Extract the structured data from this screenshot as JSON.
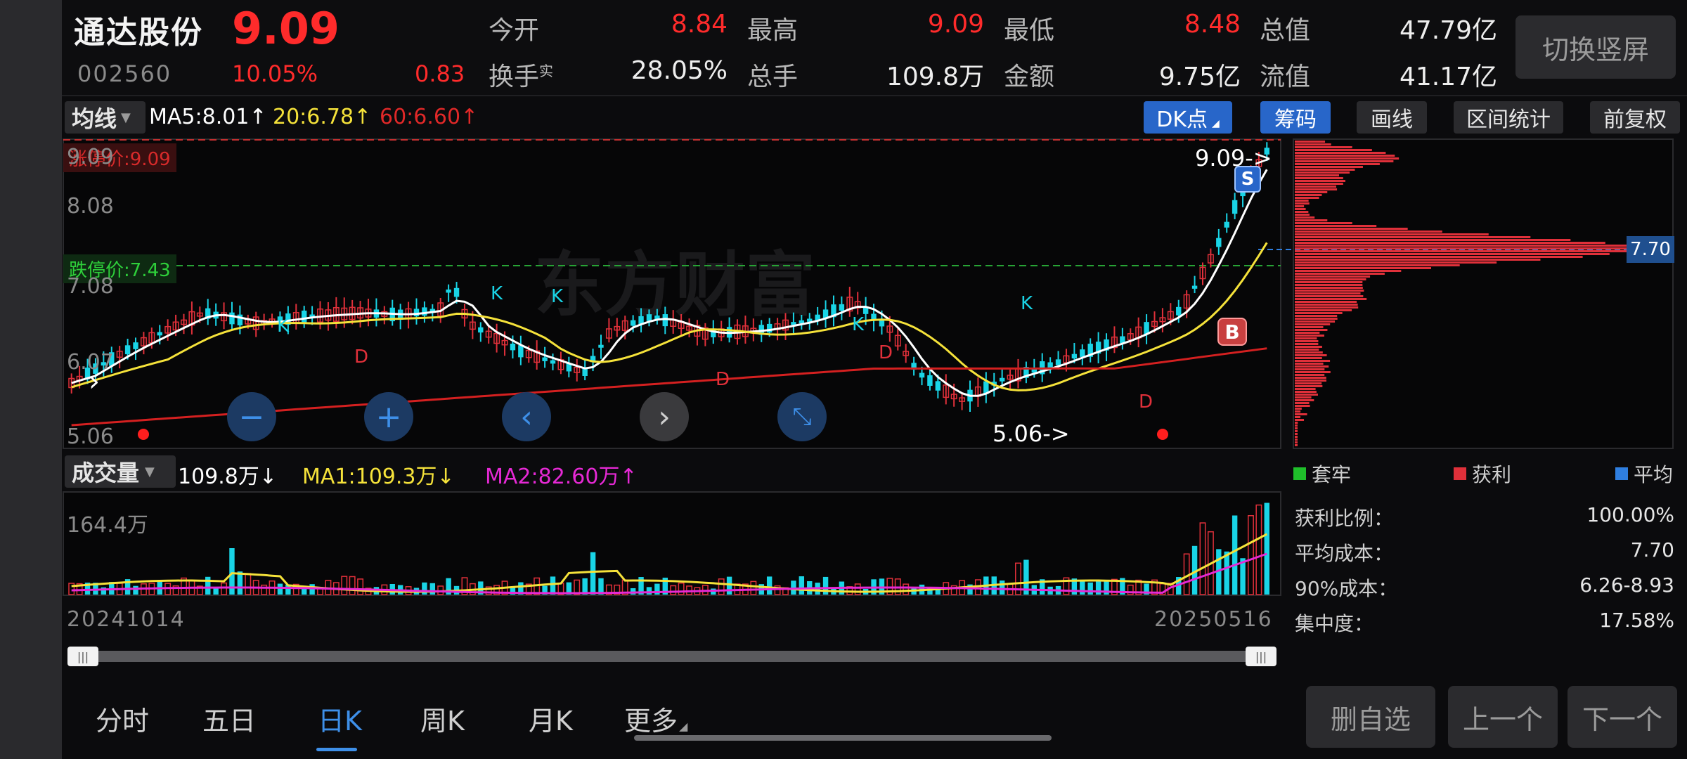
{
  "header": {
    "name": "通达股份",
    "price": "9.09",
    "code": "002560",
    "pct": "10.05%",
    "change": "0.83",
    "fields": [
      {
        "label": "今开",
        "value": "8.84",
        "color": "#ff2b2b"
      },
      {
        "label": "最高",
        "value": "9.09",
        "color": "#ff2b2b"
      },
      {
        "label": "最低",
        "value": "8.48",
        "color": "#ff2b2b"
      },
      {
        "label": "总值",
        "value": "47.79亿",
        "color": "#eeeeee"
      },
      {
        "label": "换手",
        "sup": "实",
        "value": "28.05%",
        "color": "#eeeeee"
      },
      {
        "label": "总手",
        "value": "109.8万",
        "color": "#eeeeee"
      },
      {
        "label": "金额",
        "value": "9.75亿",
        "color": "#eeeeee"
      },
      {
        "label": "流值",
        "value": "41.17亿",
        "color": "#eeeeee"
      }
    ],
    "switch_label": "切换竖屏"
  },
  "toolbar": {
    "indicator": "均线",
    "ma5": "MA5:8.01",
    "ma20": "20:6.78",
    "ma60": "60:6.60",
    "arrow_up": "↑",
    "arrow_down": "↓",
    "buttons": [
      "DK点",
      "筹码",
      "画线",
      "区间统计",
      "前复权"
    ]
  },
  "kline": {
    "limit_up": "涨停价:9.09",
    "limit_down": "跌停价:7.43",
    "y_labels": [
      "9.09",
      "8.08",
      "7.08",
      "6.07",
      "5.06"
    ],
    "high_mark": "9.09->",
    "low_mark": "5.06->",
    "signal_s": "S",
    "signal_b": "B",
    "k_marks": "K",
    "d_marks": "D",
    "watermark": "东方财富",
    "chip_avg": "7.70"
  },
  "volume": {
    "indicator": "成交量",
    "vol": "109.8万",
    "ma1": "MA1:109.3万",
    "ma2": "MA2:82.60万",
    "max_label": "164.4万",
    "date_start": "20241014",
    "date_end": "20250516"
  },
  "chips": {
    "legend": [
      {
        "label": "套牢",
        "color": "#1fbf2a"
      },
      {
        "label": "获利",
        "color": "#e0303a"
      },
      {
        "label": "平均",
        "color": "#2f7fe0"
      }
    ],
    "stats": [
      {
        "label": "获利比例：",
        "value": "100.00%"
      },
      {
        "label": "平均成本：",
        "value": "7.70"
      },
      {
        "label": "90%成本：",
        "value": "6.26-8.93"
      },
      {
        "label": "集中度：",
        "value": "17.58%"
      }
    ]
  },
  "tabs": [
    "分时",
    "五日",
    "日K",
    "周K",
    "月K",
    "更多"
  ],
  "actions": [
    "删自选",
    "上一个",
    "下一个"
  ],
  "slider_grip": "|||"
}
